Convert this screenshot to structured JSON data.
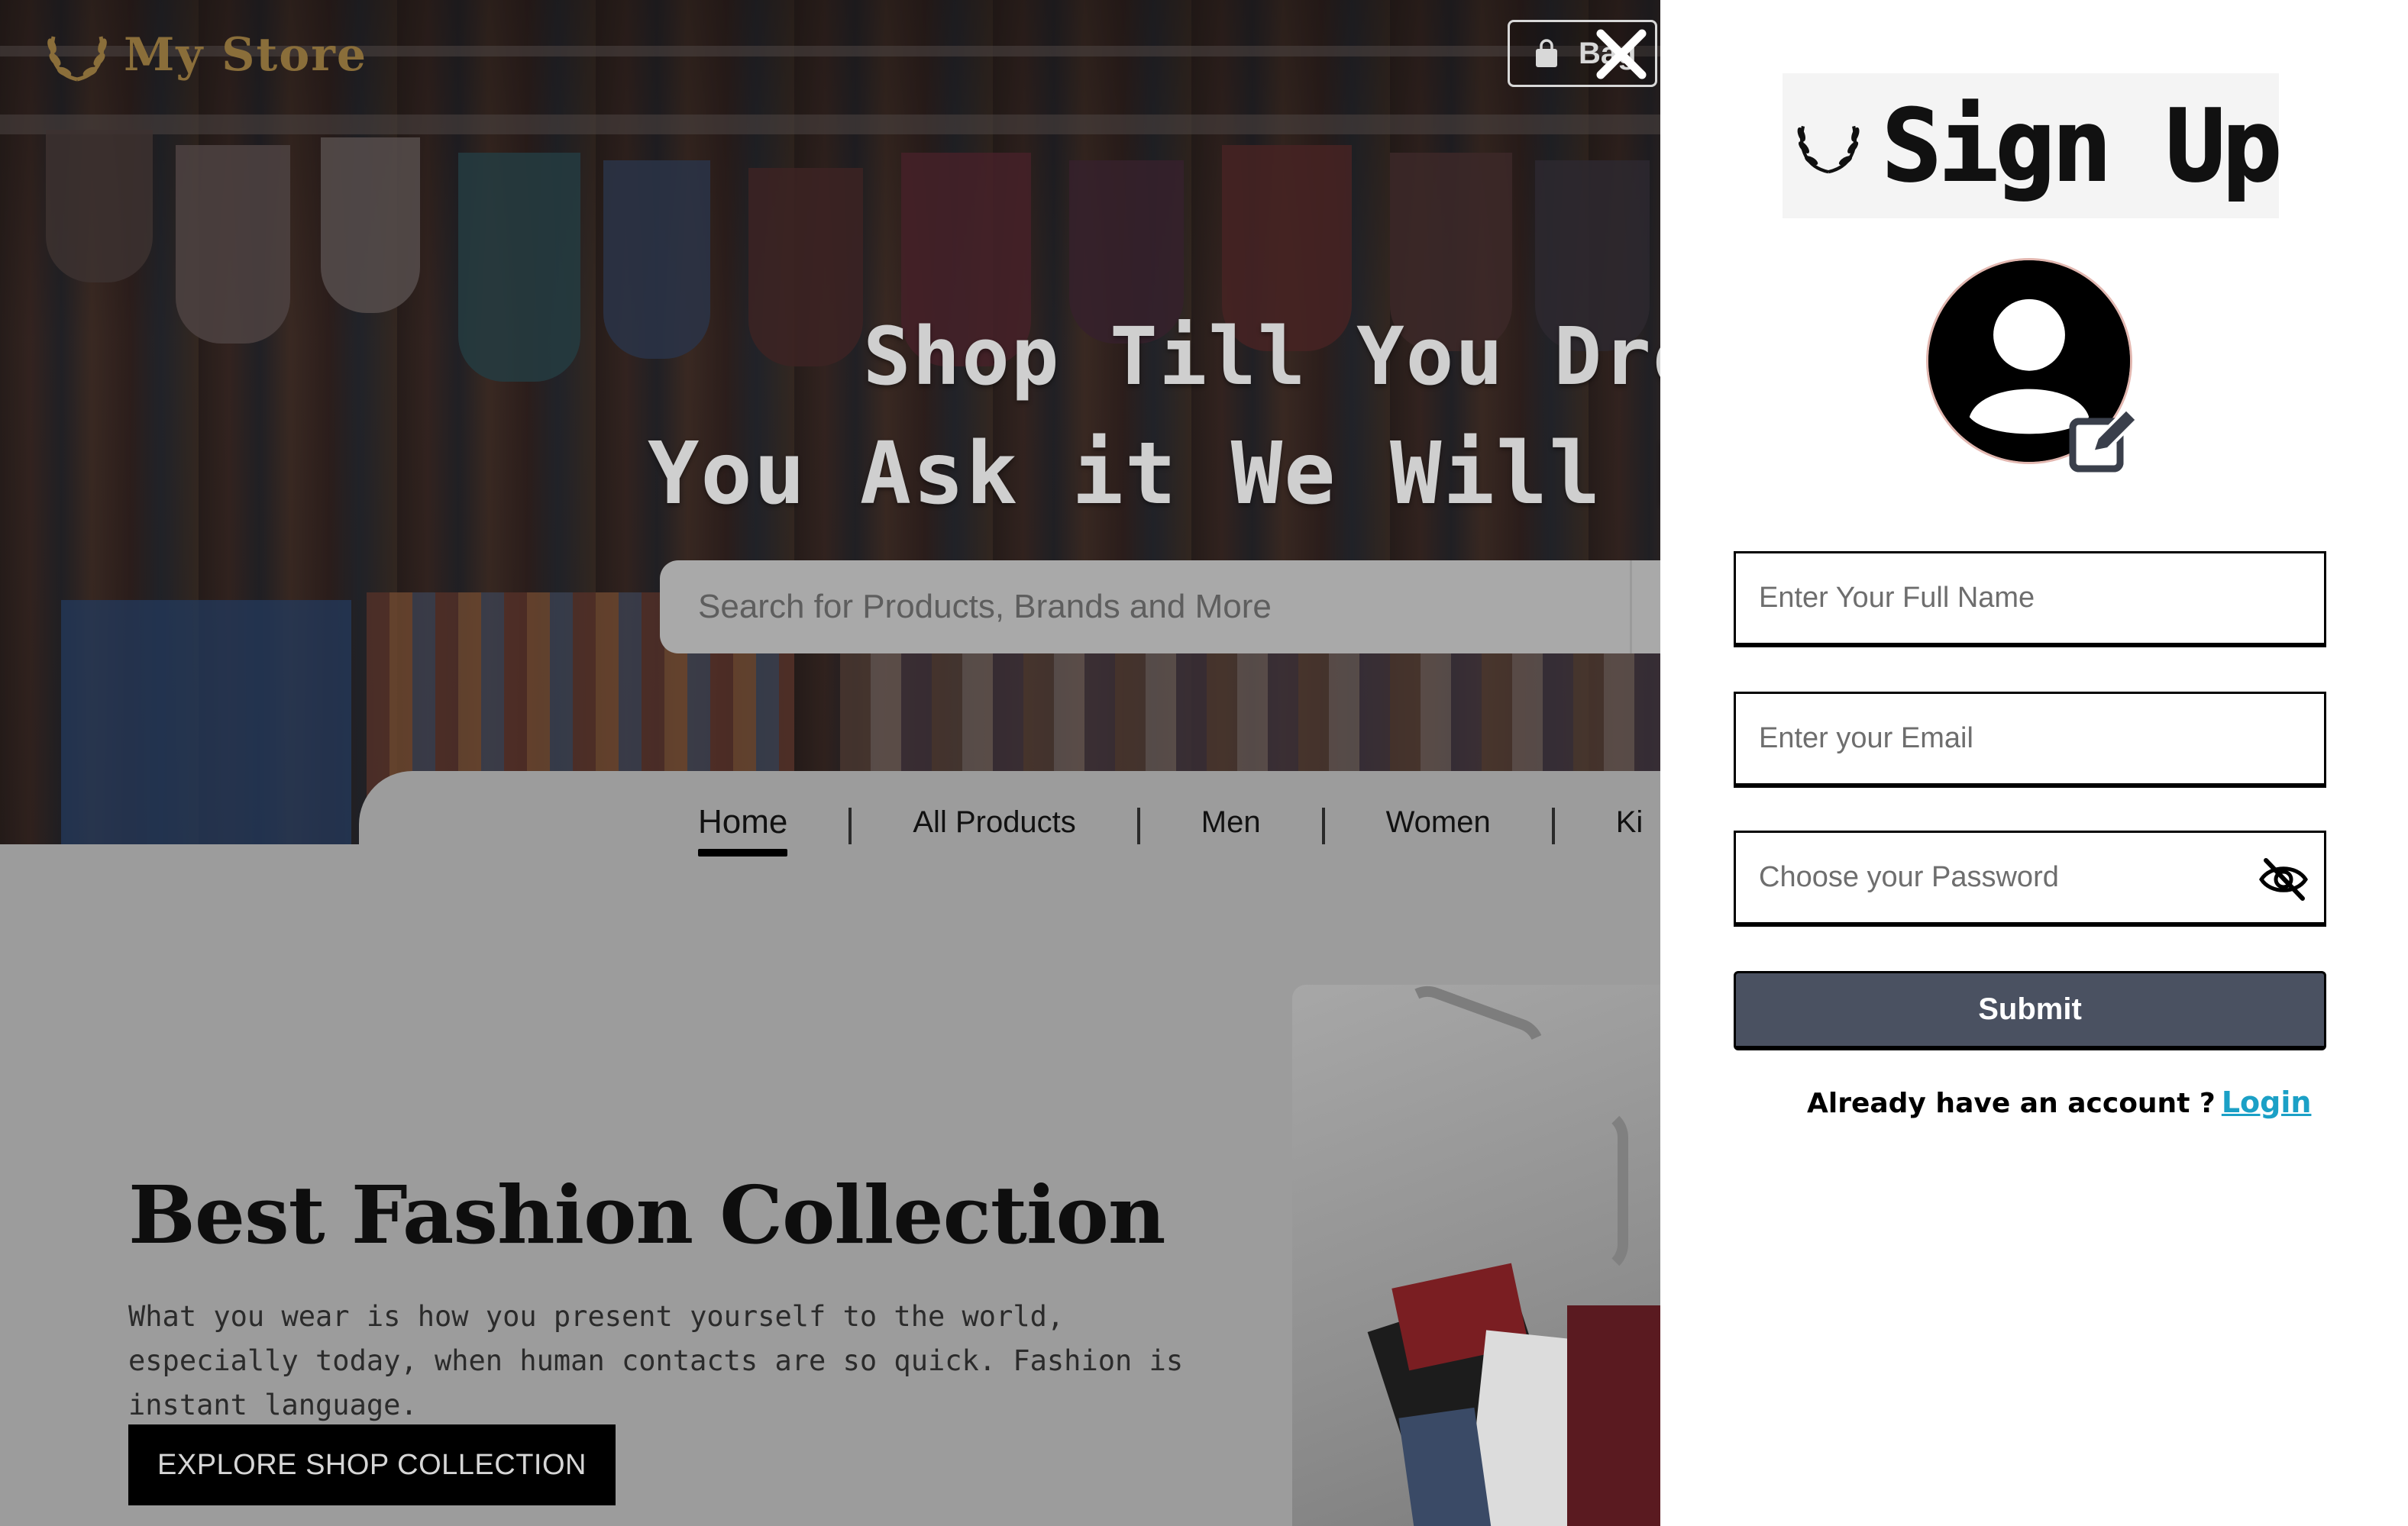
{
  "header": {
    "logo_text": "My Store",
    "bag_label": "Bag"
  },
  "hero": {
    "line1": "Shop Till You Drop",
    "line2": "You Ask it We Will Deliver"
  },
  "search": {
    "placeholder": "Search for Products, Brands and More"
  },
  "nav": {
    "items": [
      {
        "label": "Home",
        "active": true
      },
      {
        "label": "All Products"
      },
      {
        "label": "Men"
      },
      {
        "label": "Women"
      },
      {
        "label": "Ki"
      }
    ]
  },
  "section": {
    "title": "Best Fashion Collection",
    "description": "What you wear is how you present yourself to the world, especially today, when human contacts are so quick. Fashion is instant language.",
    "cta_label": "EXPLORE SHOP COLLECTION"
  },
  "modal": {
    "title": "Sign Up",
    "fields": {
      "name_placeholder": "Enter Your Full Name",
      "email_placeholder": "Enter your Email",
      "password_placeholder": "Choose your Password"
    },
    "submit_label": "Submit",
    "login_prompt": "Already have an account ?",
    "login_link": "Login"
  },
  "icons": {
    "close": "close-icon",
    "bag": "shopping-bag-icon",
    "avatar": "user-avatar-icon",
    "edit": "edit-icon",
    "password_toggle": "eye-slash-icon",
    "logo": "laurel-wreath-icon"
  },
  "colors": {
    "submit_bg": "#4a5161",
    "login_link": "#1ba0c6",
    "logo_gold": "#8a6e3a"
  }
}
